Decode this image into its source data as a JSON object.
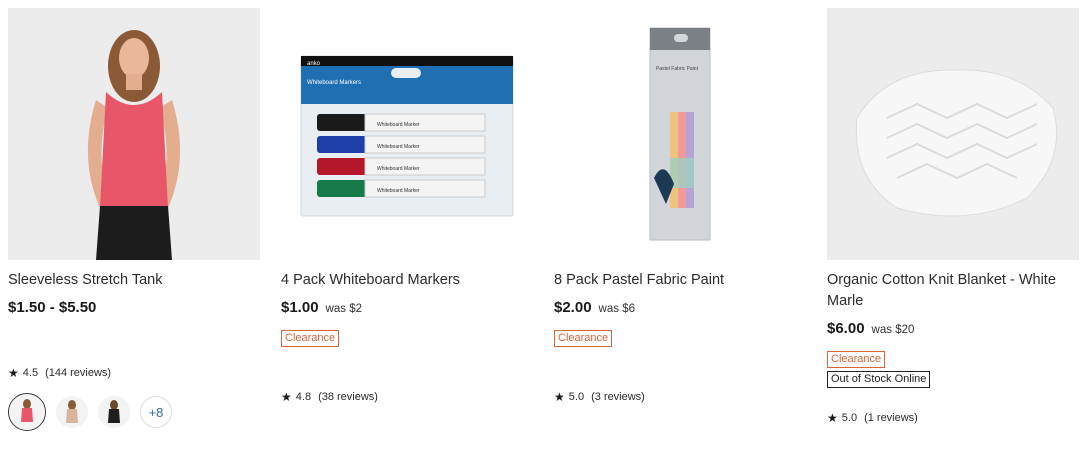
{
  "products": [
    {
      "title": "Sleeveless Stretch Tank",
      "price": "$1.50 - $5.50",
      "was": "",
      "rating": "4.5",
      "reviews": "(144 reviews)",
      "swatches_more": "+8",
      "image": "woman-in-pink-tank-photo"
    },
    {
      "title": "4 Pack Whiteboard Markers",
      "price": "$1.00",
      "was": "was $2",
      "badge": "Clearance",
      "rating": "4.8",
      "reviews": "(38 reviews)",
      "pack_brand": "anko",
      "pack_title": "Whiteboard Markers",
      "marker_label": "Whiteboard Marker",
      "image": "whiteboard-markers-pack-photo"
    },
    {
      "title": "8 Pack Pastel Fabric Paint",
      "price": "$2.00",
      "was": "was $6",
      "badge": "Clearance",
      "rating": "5.0",
      "reviews": "(3 reviews)",
      "pack_title": "Pastel Fabric Paint",
      "image": "fabric-paint-box-photo"
    },
    {
      "title": "Organic Cotton Knit Blanket - White Marle",
      "price": "$6.00",
      "was": "was $20",
      "badge": "Clearance",
      "badge2": "Out of Stock Online",
      "rating": "5.0",
      "reviews": "(1 reviews)",
      "image": "white-knit-blanket-photo"
    }
  ],
  "colors": {
    "clearance": "#d8643a",
    "image_bg": "#eeeeee",
    "tank_pink": "#e8566a",
    "more_link": "#3a6ea5"
  }
}
